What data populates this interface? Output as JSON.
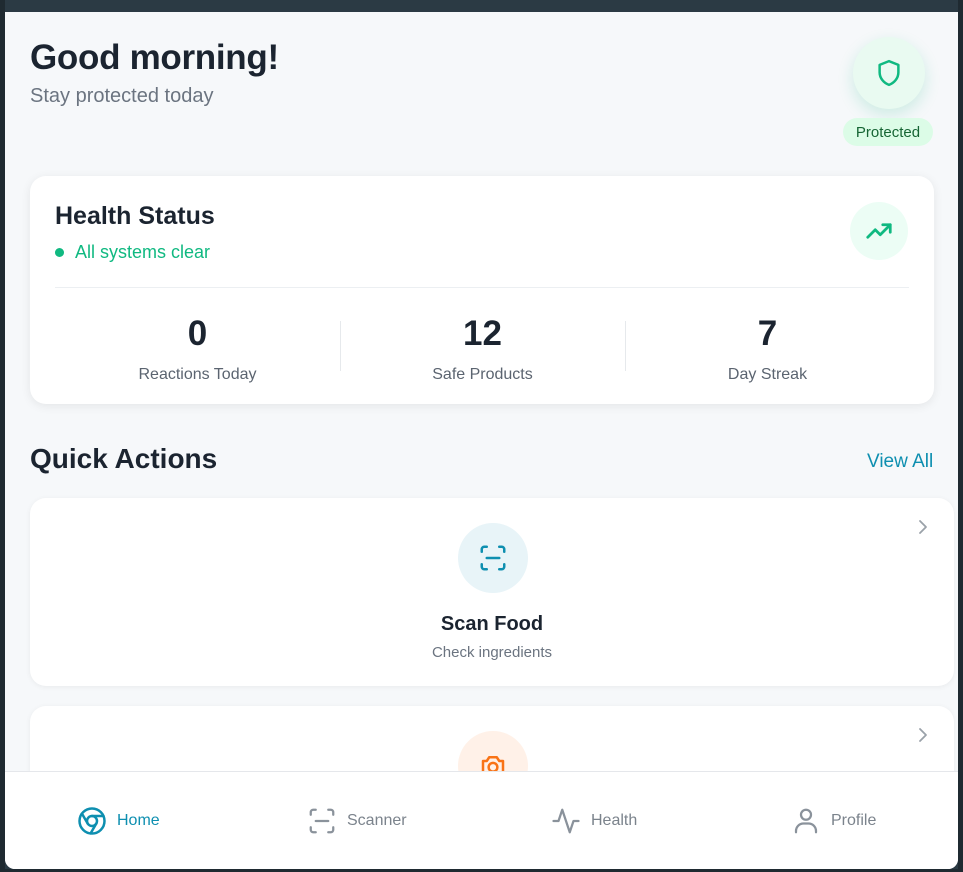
{
  "header": {
    "greeting": "Good morning!",
    "subtitle": "Stay protected today",
    "badge": "Protected",
    "icon": "shield-icon"
  },
  "health": {
    "title": "Health Status",
    "status": "All systems clear",
    "icon": "trending-up-icon",
    "stats": [
      {
        "value": "0",
        "label": "Reactions Today"
      },
      {
        "value": "12",
        "label": "Safe Products"
      },
      {
        "value": "7",
        "label": "Day Streak"
      }
    ]
  },
  "quick_actions": {
    "title": "Quick Actions",
    "view_all": "View All",
    "items": [
      {
        "title": "Scan Food",
        "subtitle": "Check ingredients",
        "icon": "scan-icon"
      },
      {
        "title": "",
        "subtitle": "",
        "icon": "camera-icon"
      }
    ]
  },
  "nav": {
    "items": [
      {
        "label": "Home",
        "icon": "home-icon",
        "active": true
      },
      {
        "label": "Scanner",
        "icon": "scanner-icon",
        "active": false
      },
      {
        "label": "Health",
        "icon": "activity-icon",
        "active": false
      },
      {
        "label": "Profile",
        "icon": "user-icon",
        "active": false
      }
    ]
  },
  "colors": {
    "accent": "#0e8fb0",
    "success": "#10b981",
    "orange": "#f97316",
    "muted": "#6b7480"
  }
}
